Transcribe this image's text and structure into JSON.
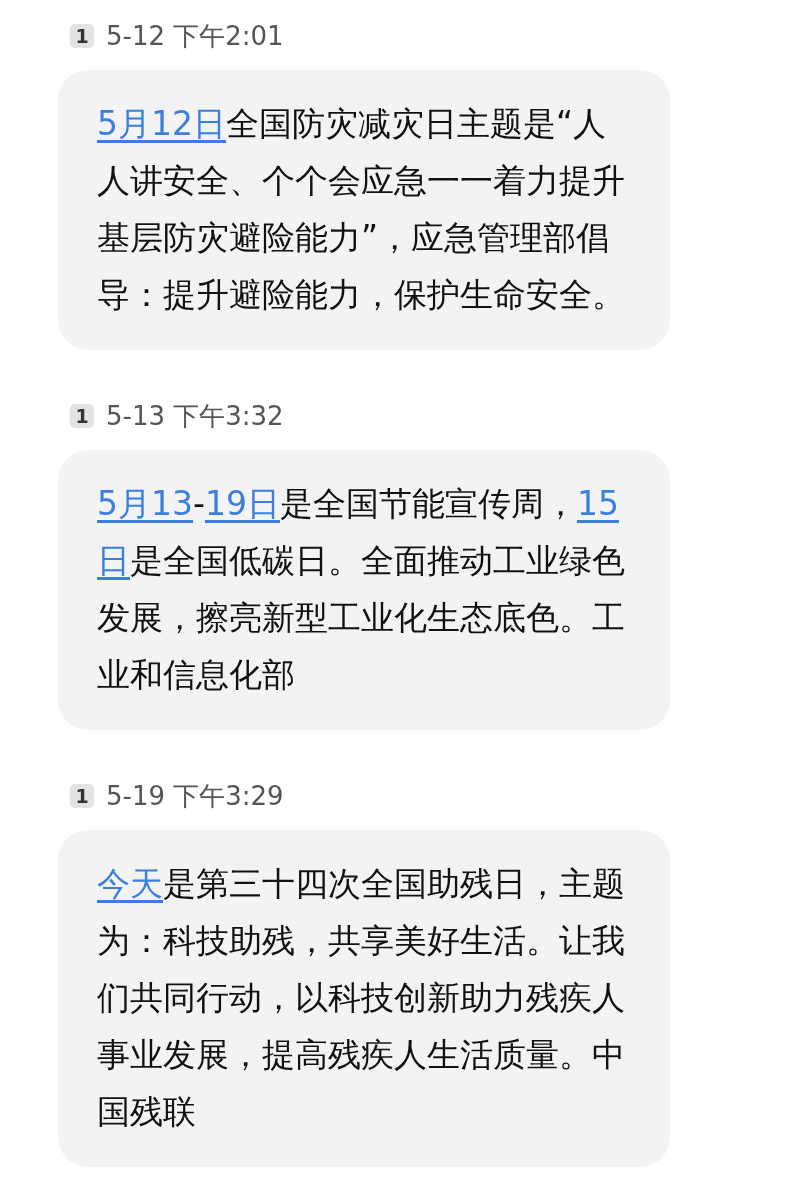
{
  "messages": [
    {
      "sim": "1",
      "time": "5-12 下午2:01",
      "segments": [
        {
          "kind": "link",
          "text": "5月12日"
        },
        {
          "kind": "text",
          "text": "全国防灾减灾日主题是“人人讲安全、个个会应急一一着力提升基层防灾避险能力”，应急管理部倡导：提升避险能力，保护生命安全。"
        }
      ]
    },
    {
      "sim": "1",
      "time": "5-13 下午3:32",
      "segments": [
        {
          "kind": "link",
          "text": "5月13"
        },
        {
          "kind": "text",
          "text": "-"
        },
        {
          "kind": "link",
          "text": "19日"
        },
        {
          "kind": "text",
          "text": "是全国节能宣传周，"
        },
        {
          "kind": "link",
          "text": "15"
        },
        {
          "kind": "link",
          "text": "日"
        },
        {
          "kind": "text",
          "text": "是全国低碳日。全面推动工业绿色发展，擦亮新型工业化生态底色。工业和信息化部"
        }
      ]
    },
    {
      "sim": "1",
      "time": "5-19 下午3:29",
      "segments": [
        {
          "kind": "link",
          "text": "今天"
        },
        {
          "kind": "text",
          "text": "是第三十四次全国助残日，主题为：科技助残，共享美好生活。让我们共同行动，以科技创新助力残疾人事业发展，提高残疾人生活质量。中国残联"
        }
      ]
    }
  ]
}
